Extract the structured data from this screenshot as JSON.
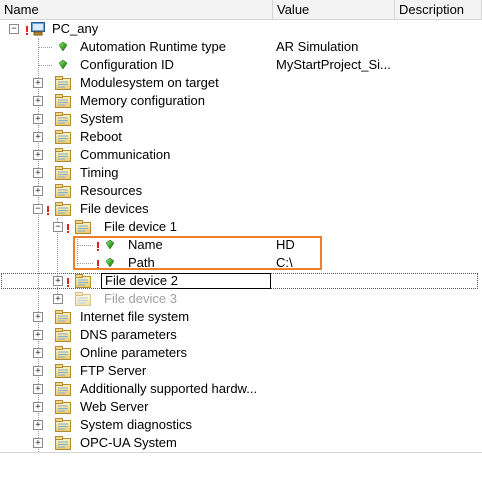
{
  "columns": {
    "name": "Name",
    "value": "Value",
    "description": "Description"
  },
  "root": {
    "label": "PC_any",
    "expander": "−"
  },
  "rows": [
    {
      "label": "Automation Runtime type",
      "value": "AR Simulation"
    },
    {
      "label": "Configuration ID",
      "value": "MyStartProject_Si..."
    },
    {
      "label": "Modulesystem on target",
      "value": ""
    },
    {
      "label": "Memory configuration",
      "value": ""
    },
    {
      "label": "System",
      "value": ""
    },
    {
      "label": "Reboot",
      "value": ""
    },
    {
      "label": "Communication",
      "value": ""
    },
    {
      "label": "Timing",
      "value": ""
    },
    {
      "label": "Resources",
      "value": ""
    },
    {
      "label": "File devices",
      "value": ""
    },
    {
      "label": "File device 1",
      "value": ""
    },
    {
      "label": "Name",
      "value": "HD"
    },
    {
      "label": "Path",
      "value": "C:\\"
    },
    {
      "label": "File device 2",
      "value": ""
    },
    {
      "label": "File device 3",
      "value": ""
    },
    {
      "label": "Internet file system",
      "value": ""
    },
    {
      "label": "DNS parameters",
      "value": ""
    },
    {
      "label": "Online parameters",
      "value": ""
    },
    {
      "label": "FTP Server",
      "value": ""
    },
    {
      "label": "Additionally supported hardw...",
      "value": ""
    },
    {
      "label": "Web Server",
      "value": ""
    },
    {
      "label": "System diagnostics",
      "value": ""
    },
    {
      "label": "OPC-UA System",
      "value": ""
    }
  ],
  "expanders": {
    "collapsed": "+",
    "expanded": "−"
  },
  "colors": {
    "highlight": "#f07d2a",
    "warning": "#e3231b",
    "disabled_text": "#a0a0a0"
  },
  "icons": {
    "root": "pc-icon",
    "parameter": "green-gem-icon",
    "group": "folder-icon",
    "warning": "warning-marker-icon"
  }
}
